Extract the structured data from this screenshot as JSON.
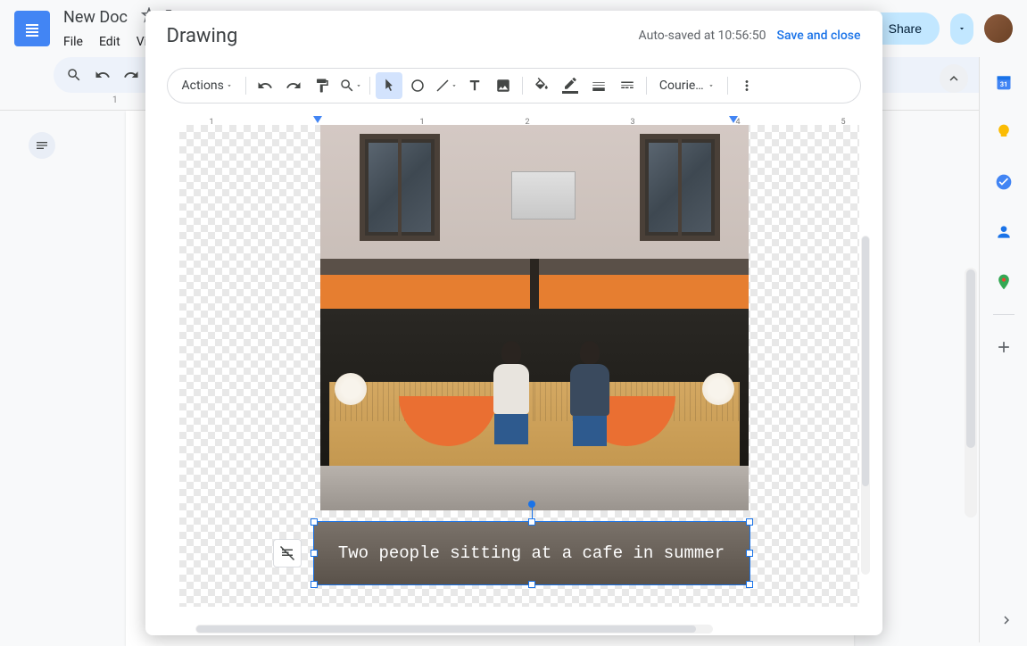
{
  "docs": {
    "title": "New Doc",
    "menus": [
      "File",
      "Edit",
      "View"
    ],
    "share_label": "Share"
  },
  "modal": {
    "title": "Drawing",
    "autosave": "Auto-saved at 10:56:50",
    "save_close": "Save and close"
  },
  "drawing_toolbar": {
    "actions": "Actions",
    "font": "Courie…"
  },
  "ruler": {
    "ticks": [
      "1",
      "1",
      "2",
      "3",
      "4",
      "5"
    ],
    "page_number": "1"
  },
  "textbox": {
    "content": "Two people sitting at a cafe in summer"
  },
  "colors": {
    "accent": "#1a73e8",
    "awning": "#e67e30",
    "share_bg": "#c2e7ff"
  }
}
